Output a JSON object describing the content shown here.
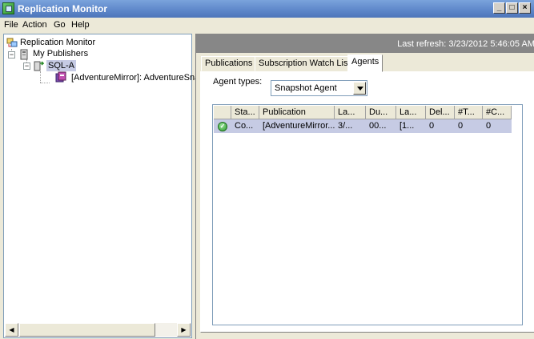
{
  "window": {
    "title": "Replication Monitor",
    "buttons": [
      "_",
      "□",
      "×"
    ]
  },
  "menu": [
    "File",
    "Action",
    "Go",
    "Help"
  ],
  "tree": {
    "root": "Replication Monitor",
    "publishers": "My Publishers",
    "server": "SQL-A",
    "publication": "[AdventureMirror]: AdventureSna"
  },
  "refresh": {
    "text": "Last refresh: 3/23/2012 5:46:05 AM"
  },
  "tabs": [
    "Publications",
    "Subscription Watch List",
    "Agents"
  ],
  "active_tab": "Agents",
  "agent_types": {
    "label": "Agent types:",
    "selected": "Snapshot Agent"
  },
  "grid": {
    "columns": [
      "Sta...",
      "Publication",
      "La...",
      "Du...",
      "La...",
      "Del...",
      "#T...",
      "#C..."
    ],
    "rows": [
      {
        "status_icon": "check-icon",
        "cells": [
          "Co...",
          "[AdventureMirror...",
          "3/...",
          "00...",
          "[1...",
          "0",
          "0",
          "0"
        ]
      }
    ]
  },
  "colors": {
    "title_bar": "#5d86c9",
    "refresh_bar": "#878787",
    "selected_row": "#c6cbe4",
    "status_ok": "#2b9a2b"
  },
  "icons": [
    "replication-monitor-icon",
    "publishers-icon",
    "server-icon",
    "publication-icon",
    "check-icon"
  ]
}
